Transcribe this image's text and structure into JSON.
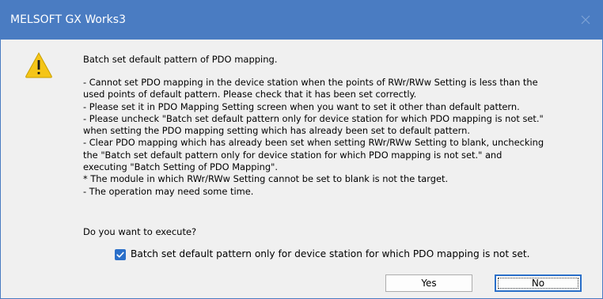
{
  "window": {
    "title": "MELSOFT GX Works3"
  },
  "icons": {
    "warning": "warning-icon",
    "close": "close-icon",
    "check": "checkmark-icon"
  },
  "colors": {
    "titlebar": "#4a7cc2",
    "checkbox": "#2a6fc9",
    "warning_fill": "#f5c518"
  },
  "message": {
    "title": "Batch set default pattern of PDO mapping.",
    "lines": [
      "- Cannot set PDO mapping in the device station when the points of RWr/RWw Setting is less than the",
      "used points of default pattern. Please check that it has been set correctly.",
      "- Please set it in PDO Mapping Setting screen when you want to set it other than default pattern.",
      "- Please uncheck \"Batch set default pattern only for device station for which PDO mapping is not set.\"",
      "when setting the PDO mapping setting which has already been set to default pattern.",
      "- Clear PDO mapping which has already been set when setting RWr/RWw Setting to blank, unchecking",
      "the \"Batch set default pattern only for device station for which PDO mapping is not set.\" and",
      "executing \"Batch Setting of PDO Mapping\".",
      "* The module in which RWr/RWw Setting cannot be set to blank is not the target.",
      "- The operation may need some time."
    ],
    "question": "Do you want to execute?"
  },
  "checkbox": {
    "label": "Batch set default pattern only for device station for which PDO mapping is not set.",
    "checked": true
  },
  "buttons": {
    "yes": "Yes",
    "no": "No"
  }
}
